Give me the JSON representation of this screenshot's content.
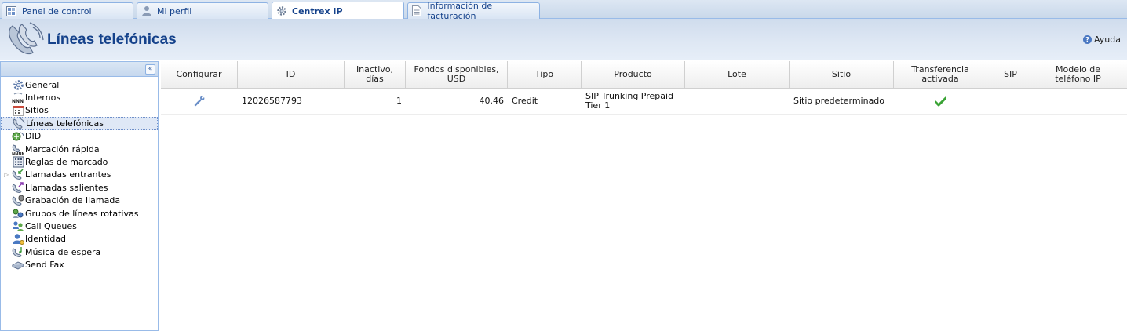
{
  "tabs": [
    {
      "label": "Panel de control",
      "icon": "dashboard-icon"
    },
    {
      "label": "Mi perfil",
      "icon": "user-icon"
    },
    {
      "label": "Centrex IP",
      "icon": "gear-icon",
      "active": true
    },
    {
      "label": "Información de facturación",
      "icon": "document-icon"
    }
  ],
  "header": {
    "title": "Líneas telefónicas",
    "help_label": "Ayuda"
  },
  "sidebar": {
    "collapse_glyph": "«",
    "items": [
      {
        "label": "General",
        "icon": "gear-icon"
      },
      {
        "label": "Internos",
        "icon": "extensions-icon"
      },
      {
        "label": "Sitios",
        "icon": "sites-icon"
      },
      {
        "label": "Líneas telefónicas",
        "icon": "phone-line-icon",
        "active": true
      },
      {
        "label": "DID",
        "icon": "did-icon"
      },
      {
        "label": "Marcación rápida",
        "icon": "speed-dial-icon"
      },
      {
        "label": "Reglas de marcado",
        "icon": "dial-rules-icon"
      },
      {
        "label": "Llamadas entrantes",
        "icon": "incoming-call-icon",
        "expandable": true
      },
      {
        "label": "Llamadas salientes",
        "icon": "outgoing-call-icon"
      },
      {
        "label": "Grabación de llamada",
        "icon": "call-recording-icon"
      },
      {
        "label": "Grupos de líneas rotativas",
        "icon": "hunt-group-icon"
      },
      {
        "label": "Call Queues",
        "icon": "call-queue-icon"
      },
      {
        "label": "Identidad",
        "icon": "identity-icon"
      },
      {
        "label": "Música de espera",
        "icon": "music-on-hold-icon"
      },
      {
        "label": "Send Fax",
        "icon": "fax-icon"
      }
    ]
  },
  "table": {
    "columns": [
      "Configurar",
      "ID",
      "Inactivo, días",
      "Fondos disponibles, USD",
      "Tipo",
      "Producto",
      "Lote",
      "Sitio",
      "Transferencia activada",
      "SIP",
      "Modelo de teléfono IP"
    ],
    "rows": [
      {
        "configure_icon": "wrench-icon",
        "id": "12026587793",
        "inactive_days": "1",
        "funds": "40.46",
        "type": "Credit",
        "product": "SIP Trunking Prepaid Tier 1",
        "batch": "",
        "site": "Sitio predeterminado",
        "transfer_icon": "checkmark-icon",
        "sip": "",
        "phone_model": ""
      }
    ]
  },
  "colors": {
    "accent": "#15428b",
    "border": "#99bbe8",
    "check": "#3aa335"
  }
}
